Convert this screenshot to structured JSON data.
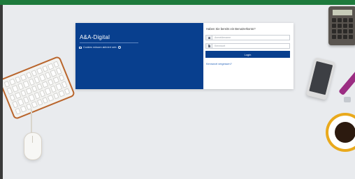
{
  "brand": {
    "title": "A&A-Digital",
    "notice": "Cookies müssen aktiviert sein"
  },
  "login": {
    "heading": "Haben Sie bereits ein Benutzerkonto?",
    "username_placeholder": "Anmeldename",
    "password_placeholder": "Kennwort",
    "login_label": "Login",
    "forgot_label": "Kennwort vergessen?"
  },
  "colors": {
    "brand_blue": "#083f8e",
    "top_bar_green": "#1e7a3c",
    "desk_background": "#e9ebee"
  }
}
